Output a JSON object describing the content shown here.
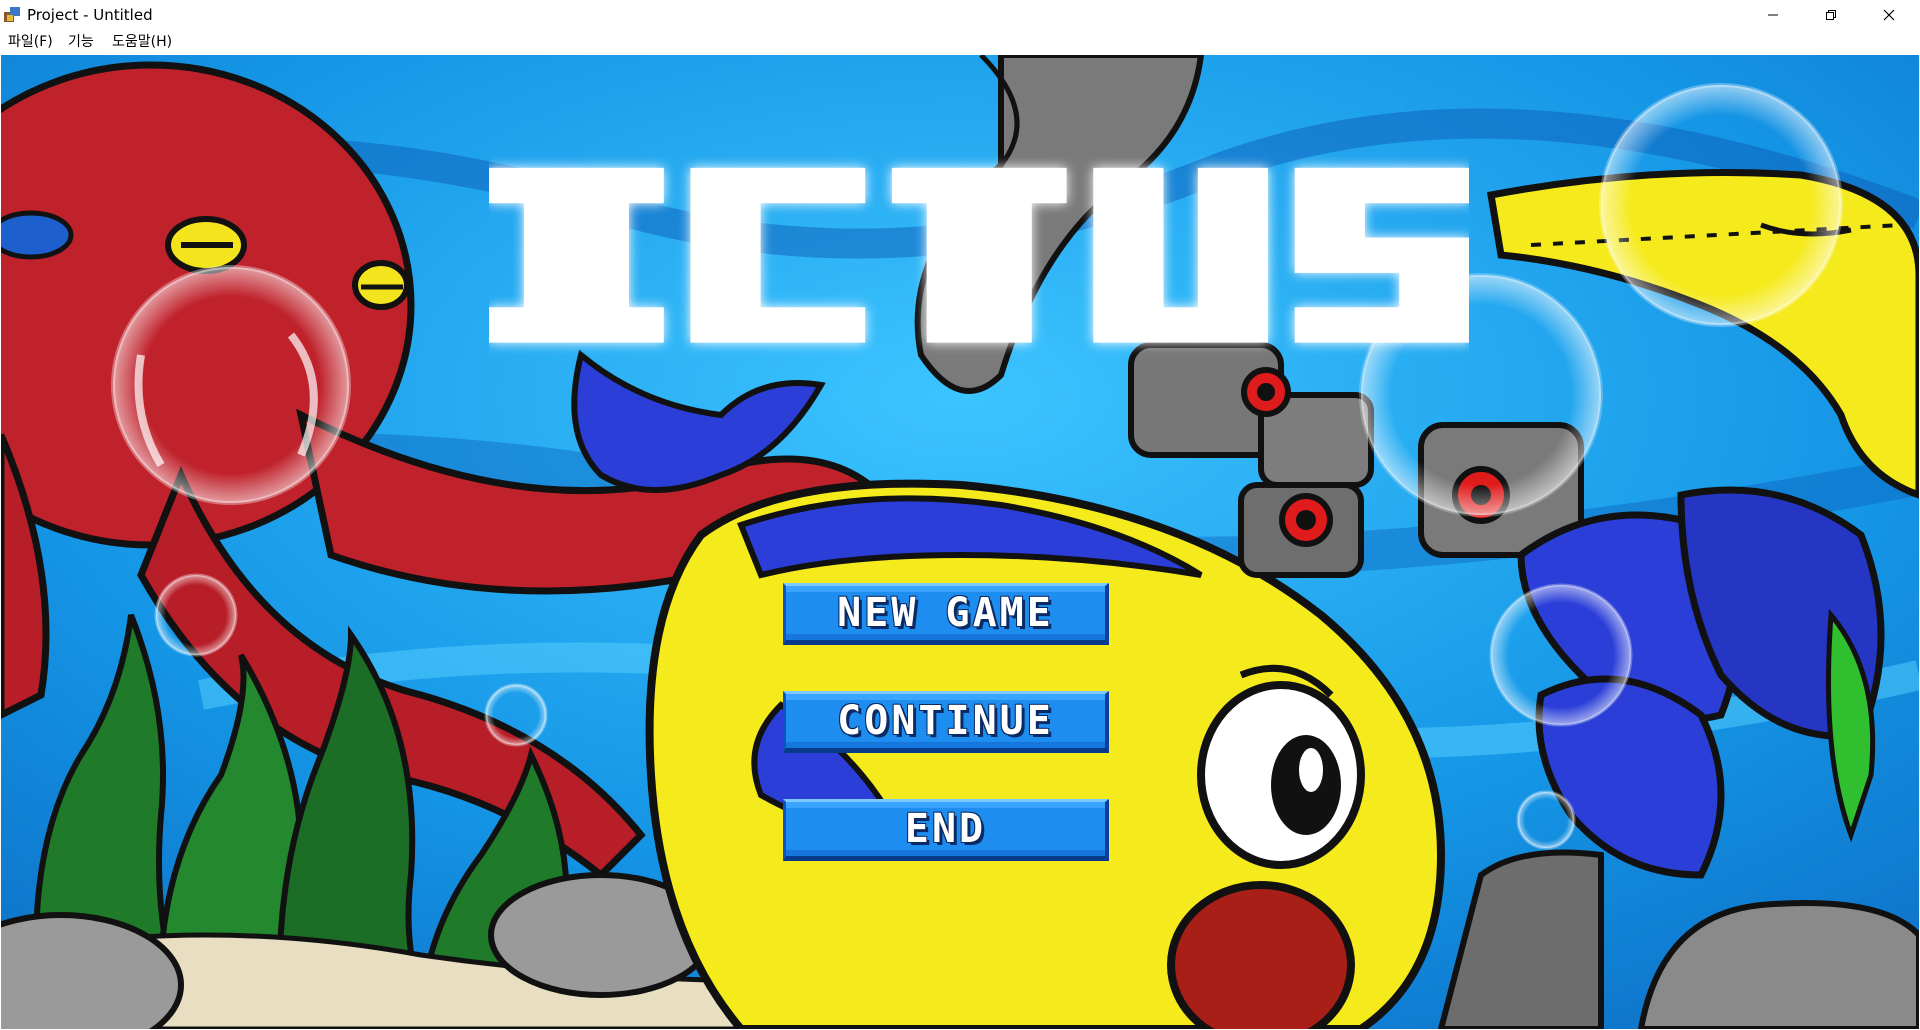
{
  "window": {
    "title": "Project - Untitled",
    "controls": {
      "minimize": "minimize-icon",
      "maximize": "restore-icon",
      "close": "close-icon"
    }
  },
  "menu": {
    "items": [
      {
        "label": "파일(F)",
        "underline": "F"
      },
      {
        "label": "기능"
      },
      {
        "label": "도움말(H)",
        "underline": "H"
      }
    ]
  },
  "game": {
    "title": "ICTUS",
    "buttons": [
      {
        "label": "NEW GAME"
      },
      {
        "label": "CONTINUE"
      },
      {
        "label": "END"
      }
    ],
    "colors": {
      "water": "#19a7f0",
      "button": "#1e8df0",
      "octopus": "#c0222c",
      "yellow_fish": "#f5ea1c",
      "seaweed": "#1f7a2a"
    }
  }
}
